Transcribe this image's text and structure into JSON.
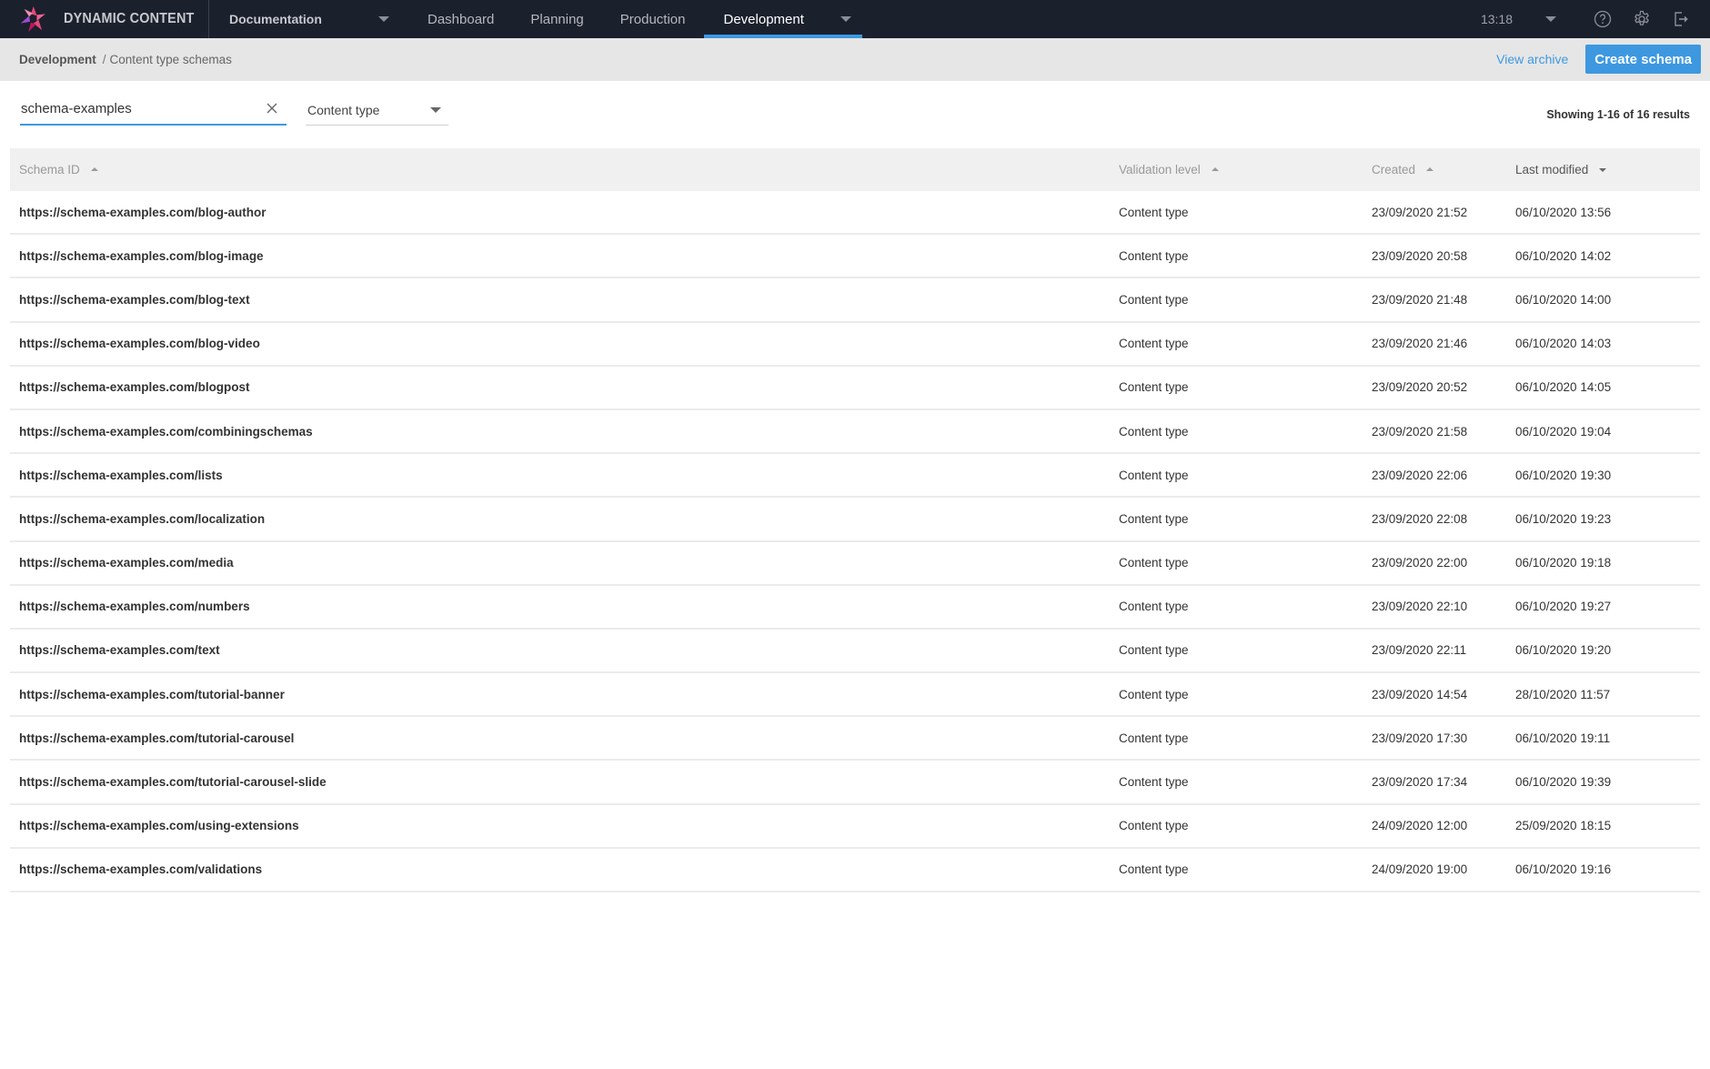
{
  "app": {
    "brand": "DYNAMIC CONTENT",
    "hub": "Documentation",
    "nav": [
      {
        "label": "Dashboard",
        "active": false
      },
      {
        "label": "Planning",
        "active": false
      },
      {
        "label": "Production",
        "active": false
      },
      {
        "label": "Development",
        "active": true
      }
    ],
    "clock": "13:18",
    "icons": [
      "help-icon",
      "settings-icon",
      "logout-icon"
    ],
    "accent": "#3d98e0",
    "topbar_bg": "#1b202d"
  },
  "breadcrumb": {
    "root": "Development",
    "separator": "/",
    "current": "Content type schemas"
  },
  "actions": {
    "view_archive": "View archive",
    "create_schema": "Create schema"
  },
  "filters": {
    "search_value": "schema-examples",
    "type_select": "Content type",
    "results_text": "Showing 1-16 of 16 results"
  },
  "table": {
    "columns": [
      {
        "label": "Schema ID",
        "sort": "asc",
        "active": false
      },
      {
        "label": "Validation level",
        "sort": "asc",
        "active": false
      },
      {
        "label": "Created",
        "sort": "asc",
        "active": false
      },
      {
        "label": "Last modified",
        "sort": "desc",
        "active": true
      }
    ],
    "rows": [
      {
        "id": "https://schema-examples.com/blog-author",
        "validation": "Content type",
        "created": "23/09/2020 21:52",
        "modified": "06/10/2020 13:56"
      },
      {
        "id": "https://schema-examples.com/blog-image",
        "validation": "Content type",
        "created": "23/09/2020 20:58",
        "modified": "06/10/2020 14:02"
      },
      {
        "id": "https://schema-examples.com/blog-text",
        "validation": "Content type",
        "created": "23/09/2020 21:48",
        "modified": "06/10/2020 14:00"
      },
      {
        "id": "https://schema-examples.com/blog-video",
        "validation": "Content type",
        "created": "23/09/2020 21:46",
        "modified": "06/10/2020 14:03"
      },
      {
        "id": "https://schema-examples.com/blogpost",
        "validation": "Content type",
        "created": "23/09/2020 20:52",
        "modified": "06/10/2020 14:05"
      },
      {
        "id": "https://schema-examples.com/combiningschemas",
        "validation": "Content type",
        "created": "23/09/2020 21:58",
        "modified": "06/10/2020 19:04"
      },
      {
        "id": "https://schema-examples.com/lists",
        "validation": "Content type",
        "created": "23/09/2020 22:06",
        "modified": "06/10/2020 19:30"
      },
      {
        "id": "https://schema-examples.com/localization",
        "validation": "Content type",
        "created": "23/09/2020 22:08",
        "modified": "06/10/2020 19:23"
      },
      {
        "id": "https://schema-examples.com/media",
        "validation": "Content type",
        "created": "23/09/2020 22:00",
        "modified": "06/10/2020 19:18"
      },
      {
        "id": "https://schema-examples.com/numbers",
        "validation": "Content type",
        "created": "23/09/2020 22:10",
        "modified": "06/10/2020 19:27"
      },
      {
        "id": "https://schema-examples.com/text",
        "validation": "Content type",
        "created": "23/09/2020 22:11",
        "modified": "06/10/2020 19:20"
      },
      {
        "id": "https://schema-examples.com/tutorial-banner",
        "validation": "Content type",
        "created": "23/09/2020 14:54",
        "modified": "28/10/2020 11:57"
      },
      {
        "id": "https://schema-examples.com/tutorial-carousel",
        "validation": "Content type",
        "created": "23/09/2020 17:30",
        "modified": "06/10/2020 19:11"
      },
      {
        "id": "https://schema-examples.com/tutorial-carousel-slide",
        "validation": "Content type",
        "created": "23/09/2020 17:34",
        "modified": "06/10/2020 19:39"
      },
      {
        "id": "https://schema-examples.com/using-extensions",
        "validation": "Content type",
        "created": "24/09/2020 12:00",
        "modified": "25/09/2020 18:15"
      },
      {
        "id": "https://schema-examples.com/validations",
        "validation": "Content type",
        "created": "24/09/2020 19:00",
        "modified": "06/10/2020 19:16"
      }
    ]
  }
}
